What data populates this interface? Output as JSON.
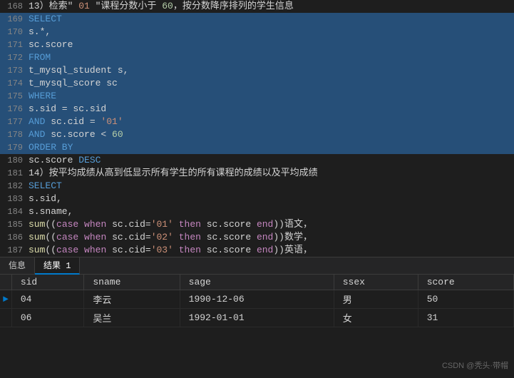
{
  "editor": {
    "lines": [
      {
        "num": "168",
        "selected": false,
        "tokens": [
          {
            "type": "plain",
            "text": "13）检索\" "
          },
          {
            "type": "str",
            "text": "01"
          },
          {
            "type": "plain",
            "text": " \"课程分数小于 "
          },
          {
            "type": "num",
            "text": "60"
          },
          {
            "type": "plain",
            "text": "，按分数降序排列的学生信息"
          }
        ]
      },
      {
        "num": "169",
        "selected": true,
        "tokens": [
          {
            "type": "kw",
            "text": "SELECT"
          }
        ]
      },
      {
        "num": "170",
        "selected": true,
        "tokens": [
          {
            "type": "plain",
            "text": "    s.*,"
          }
        ]
      },
      {
        "num": "171",
        "selected": true,
        "tokens": [
          {
            "type": "plain",
            "text": "    sc.score"
          }
        ]
      },
      {
        "num": "172",
        "selected": true,
        "tokens": [
          {
            "type": "kw",
            "text": "FROM"
          }
        ]
      },
      {
        "num": "173",
        "selected": true,
        "tokens": [
          {
            "type": "plain",
            "text": "    t_mysql_student s,"
          }
        ]
      },
      {
        "num": "174",
        "selected": true,
        "tokens": [
          {
            "type": "plain",
            "text": "    t_mysql_score sc"
          }
        ]
      },
      {
        "num": "175",
        "selected": true,
        "tokens": [
          {
            "type": "kw",
            "text": "WHERE"
          }
        ]
      },
      {
        "num": "176",
        "selected": true,
        "tokens": [
          {
            "type": "plain",
            "text": "    s.sid = sc.sid"
          }
        ]
      },
      {
        "num": "177",
        "selected": true,
        "tokens": [
          {
            "type": "plain",
            "text": "    "
          },
          {
            "type": "kw",
            "text": "AND"
          },
          {
            "type": "plain",
            "text": " sc.cid = "
          },
          {
            "type": "str",
            "text": "'01'"
          }
        ]
      },
      {
        "num": "178",
        "selected": true,
        "tokens": [
          {
            "type": "plain",
            "text": "    "
          },
          {
            "type": "kw",
            "text": "AND"
          },
          {
            "type": "plain",
            "text": " sc.score < "
          },
          {
            "type": "num",
            "text": "60"
          }
        ]
      },
      {
        "num": "179",
        "selected": true,
        "tokens": [
          {
            "type": "kw",
            "text": "ORDER BY"
          }
        ]
      },
      {
        "num": "180",
        "selected": false,
        "tokens": [
          {
            "type": "plain",
            "text": "    sc.score "
          },
          {
            "type": "kw",
            "text": "DESC"
          }
        ]
      },
      {
        "num": "181",
        "selected": false,
        "tokens": [
          {
            "type": "plain",
            "text": "14）按平均成绩从高到低显示所有学生的所有课程的成绩以及平均成绩"
          }
        ]
      },
      {
        "num": "182",
        "selected": false,
        "tokens": [
          {
            "type": "kw",
            "text": "SELECT"
          }
        ]
      },
      {
        "num": "183",
        "selected": false,
        "tokens": [
          {
            "type": "plain",
            "text": "    s.sid,"
          }
        ]
      },
      {
        "num": "184",
        "selected": false,
        "tokens": [
          {
            "type": "plain",
            "text": "    s.sname,"
          }
        ]
      },
      {
        "num": "185",
        "selected": false,
        "tokens": [
          {
            "type": "plain",
            "text": "    "
          },
          {
            "type": "fn",
            "text": "sum"
          },
          {
            "type": "plain",
            "text": "(("
          },
          {
            "type": "kw-orange",
            "text": "case"
          },
          {
            "type": "plain",
            "text": " "
          },
          {
            "type": "kw-orange",
            "text": "when"
          },
          {
            "type": "plain",
            "text": " sc.cid="
          },
          {
            "type": "str",
            "text": "'01'"
          },
          {
            "type": "plain",
            "text": " "
          },
          {
            "type": "then-kw",
            "text": "then"
          },
          {
            "type": "plain",
            "text": " sc.score "
          },
          {
            "type": "kw-orange",
            "text": "end"
          },
          {
            "type": "plain",
            "text": "))语文，"
          }
        ]
      },
      {
        "num": "186",
        "selected": false,
        "tokens": [
          {
            "type": "plain",
            "text": "    "
          },
          {
            "type": "fn",
            "text": "sum"
          },
          {
            "type": "plain",
            "text": "(("
          },
          {
            "type": "kw-orange",
            "text": "case"
          },
          {
            "type": "plain",
            "text": " "
          },
          {
            "type": "kw-orange",
            "text": "when"
          },
          {
            "type": "plain",
            "text": " sc.cid="
          },
          {
            "type": "str",
            "text": "'02'"
          },
          {
            "type": "plain",
            "text": " "
          },
          {
            "type": "then-kw",
            "text": "then"
          },
          {
            "type": "plain",
            "text": " sc.score "
          },
          {
            "type": "kw-orange",
            "text": "end"
          },
          {
            "type": "plain",
            "text": "))数学，"
          }
        ]
      },
      {
        "num": "187",
        "selected": false,
        "tokens": [
          {
            "type": "plain",
            "text": "    "
          },
          {
            "type": "fn",
            "text": "sum"
          },
          {
            "type": "plain",
            "text": "(("
          },
          {
            "type": "kw-orange",
            "text": "case"
          },
          {
            "type": "plain",
            "text": " "
          },
          {
            "type": "kw-orange",
            "text": "when"
          },
          {
            "type": "plain",
            "text": " sc.cid="
          },
          {
            "type": "str",
            "text": "'03'"
          },
          {
            "type": "plain",
            "text": " "
          },
          {
            "type": "then-kw",
            "text": "then"
          },
          {
            "type": "plain",
            "text": " sc.score "
          },
          {
            "type": "kw-orange",
            "text": "end"
          },
          {
            "type": "plain",
            "text": "))英语，"
          }
        ]
      }
    ]
  },
  "bottom": {
    "tabs": [
      "信息",
      "结果 1"
    ],
    "active_tab": "结果 1",
    "table": {
      "headers": [
        "sid",
        "sname",
        "sage",
        "ssex",
        "score"
      ],
      "rows": [
        {
          "arrow": true,
          "sid": "04",
          "sname": "李云",
          "sage": "1990-12-06",
          "ssex": "男",
          "score": "50"
        },
        {
          "arrow": false,
          "sid": "06",
          "sname": "吴兰",
          "sage": "1992-01-01",
          "ssex": "女",
          "score": "31"
        }
      ]
    }
  },
  "watermark": {
    "text": "CSDN @秃头·带帽"
  }
}
